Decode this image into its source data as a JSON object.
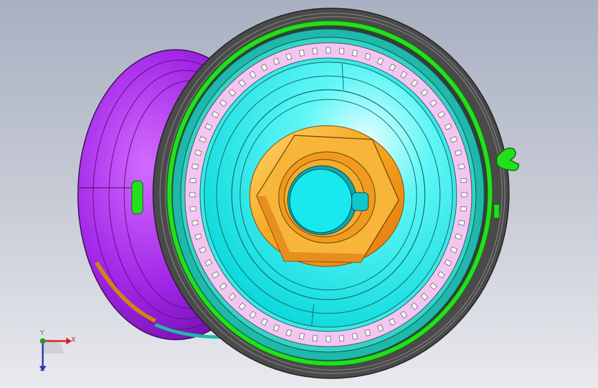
{
  "viewport": {
    "background_top": "#a9b0c1",
    "background_bottom": "#e9eaef"
  },
  "model": {
    "colors": {
      "back_disc": "#9b1fe0",
      "back_disc_light": "#c04bff",
      "edge_ring": "#3a3a3a",
      "green_ring": "#22e01e",
      "teal_ring": "#1fb8aa",
      "pink_ring": "#f2c6f0",
      "cyan_face": "#14f2f0",
      "hex_nut": "#f5a51c",
      "hex_nut_dark": "#e07a10",
      "bore": "#19e8ef"
    }
  },
  "triad": {
    "x_label": "X",
    "y_label": "Y",
    "z_label": "Z",
    "x_color": "#d42020",
    "y_color": "#1e9a2a",
    "z_color": "#2a37b8"
  }
}
